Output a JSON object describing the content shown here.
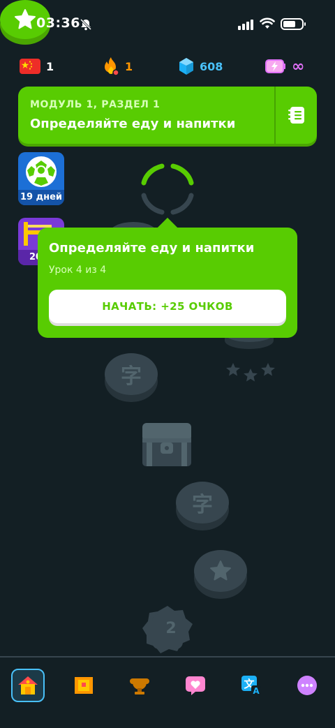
{
  "status_bar": {
    "time": "03:36"
  },
  "stats": {
    "course_count": "1",
    "streak": "1",
    "gems": "608",
    "hearts": "∞"
  },
  "unit": {
    "section_label": "МОДУЛЬ 1, РАЗДЕЛ 1",
    "title": "Определяйте еду и напитки"
  },
  "badges": {
    "streak_days": "19 дней",
    "chest_number": "20"
  },
  "popup": {
    "title": "Определяйте еду и напитки",
    "subtitle": "Урок 4 из 4",
    "start_button": "НАЧАТЬ: +25 ОЧКОВ"
  },
  "path": {
    "char_node_1": "字",
    "char_node_2": "字",
    "checkpoint_number": "2"
  },
  "colors": {
    "brand_green": "#58cc02",
    "background": "#131f24",
    "node_locked": "#37464f"
  },
  "nav": {
    "items": [
      "home-icon",
      "chest-icon",
      "trophy-icon",
      "heart-icon",
      "translate-icon",
      "more-icon"
    ]
  }
}
